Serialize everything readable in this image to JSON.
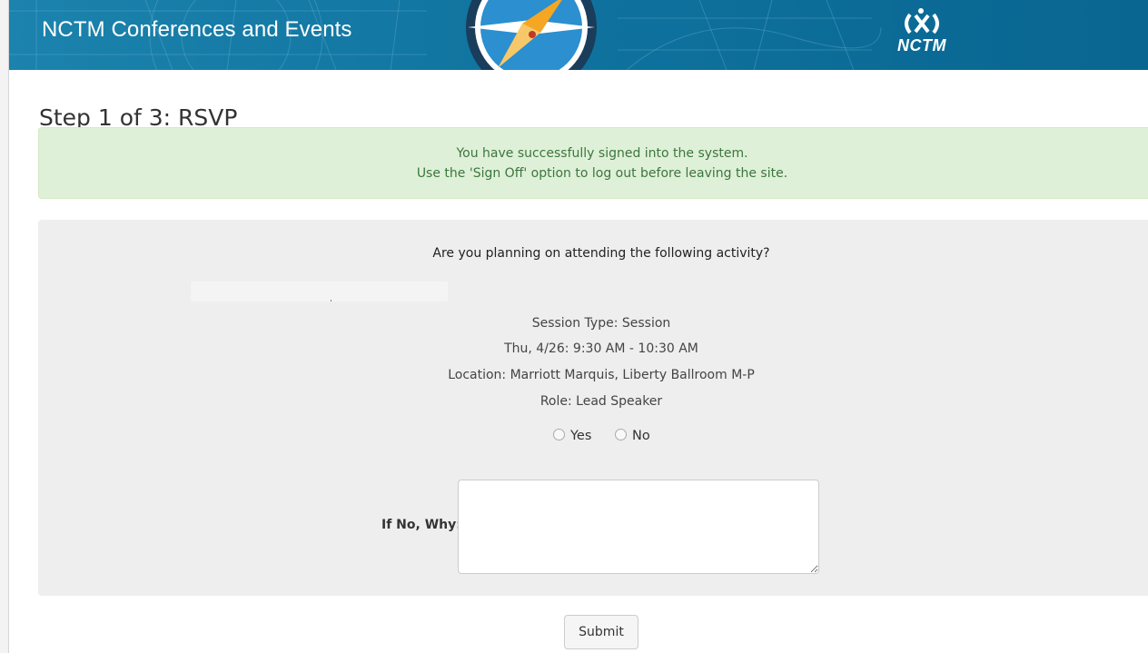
{
  "header": {
    "site_title": "NCTM Conferences and Events",
    "logo_text": "NCTM",
    "brand_color": "#0c6d97"
  },
  "page": {
    "title": "Step 1 of 3: RSVP"
  },
  "alert": {
    "line1": "You have successfully signed into the system.",
    "line2": "Use the 'Sign Off' option to log out before leaving the site.",
    "bg_color": "#dff0d8",
    "text_color": "#3c763d"
  },
  "rsvp": {
    "question": "Are you planning on attending the following activity?",
    "session_type": "Session Type: Session",
    "datetime": "Thu, 4/26: 9:30 AM - 10:30 AM",
    "location": "Location: Marriott Marquis, Liberty Ballroom M-P",
    "role": "Role: Lead Speaker",
    "options": [
      {
        "label": "Yes",
        "selected": false
      },
      {
        "label": "No",
        "selected": false
      }
    ],
    "why_label": "If No, Why:",
    "why_value": ""
  },
  "actions": {
    "submit_label": "Submit"
  },
  "icons": {
    "header_emblem": "compass-icon",
    "logo": "nctm-logo-icon"
  }
}
